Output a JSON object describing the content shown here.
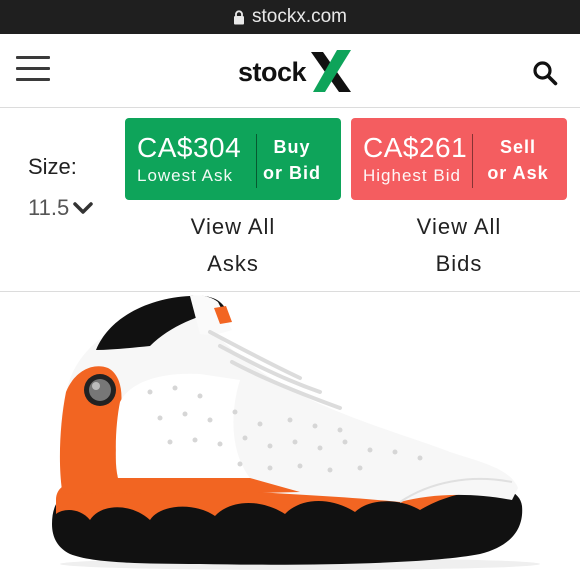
{
  "browser": {
    "url": "stockx.com"
  },
  "header": {
    "logo_text": "stock",
    "logo_x": "X",
    "brand_color": "#0ea45a"
  },
  "size": {
    "label": "Size:",
    "value": "11.5"
  },
  "ask": {
    "amount": "CA$304",
    "caption": "Lowest Ask",
    "action_line1": "Buy",
    "action_line2": "or Bid",
    "color": "#0ea45a",
    "link_line1": "View All",
    "link_line2": "Asks"
  },
  "bid": {
    "amount": "CA$261",
    "caption": "Highest Bid",
    "action_line1": "Sell",
    "action_line2": "or Ask",
    "color": "#f45d60",
    "link_line1": "View All",
    "link_line2": "Bids"
  },
  "product": {
    "image_alt": "sneaker-white-orange-black"
  }
}
